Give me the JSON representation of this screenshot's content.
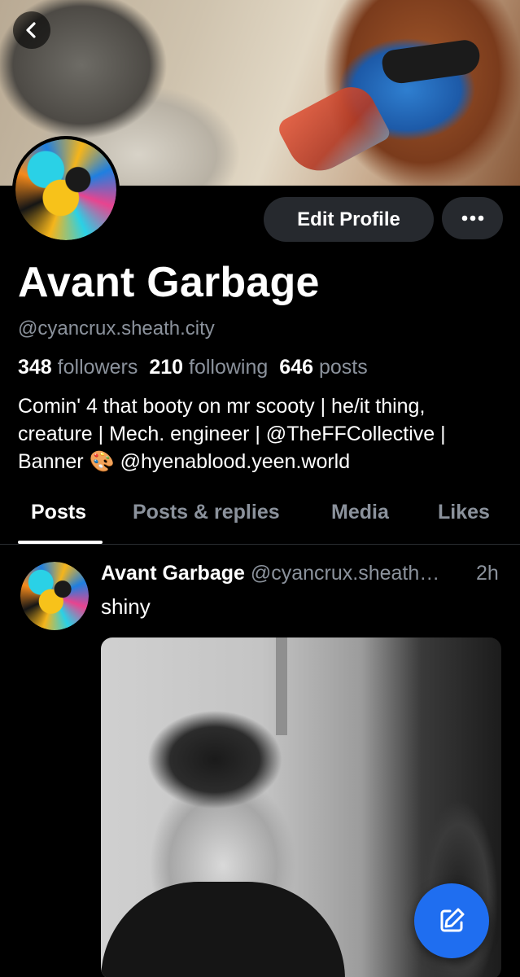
{
  "header": {
    "back_icon": "chevron-left-icon"
  },
  "profile": {
    "display_name": "Avant Garbage",
    "handle": "@cyancrux.sheath.city",
    "followers_count": "348",
    "followers_label": "followers",
    "following_count": "210",
    "following_label": "following",
    "posts_count": "646",
    "posts_label": "posts",
    "bio_line1": "Comin' 4 that booty on mr scooty | he/it thing,",
    "bio_line2": "creature | Mech. engineer | @TheFFCollective |",
    "bio_line3": "Banner 🎨 @hyenablood.yeen.world"
  },
  "actions": {
    "edit_profile_label": "Edit Profile",
    "more_icon": "ellipsis-icon"
  },
  "tabs": [
    {
      "label": "Posts",
      "active": true
    },
    {
      "label": "Posts & replies",
      "active": false
    },
    {
      "label": "Media",
      "active": false
    },
    {
      "label": "Likes",
      "active": false
    }
  ],
  "post": {
    "author_name": "Avant Garbage",
    "author_handle": "@cyancrux.sheath…",
    "time": "2h",
    "text": "shiny"
  },
  "fab": {
    "icon": "compose-icon",
    "color": "#1f6ef0"
  },
  "colors": {
    "background": "#000000",
    "muted_text": "#8b929c",
    "button_bg": "#26292e"
  }
}
